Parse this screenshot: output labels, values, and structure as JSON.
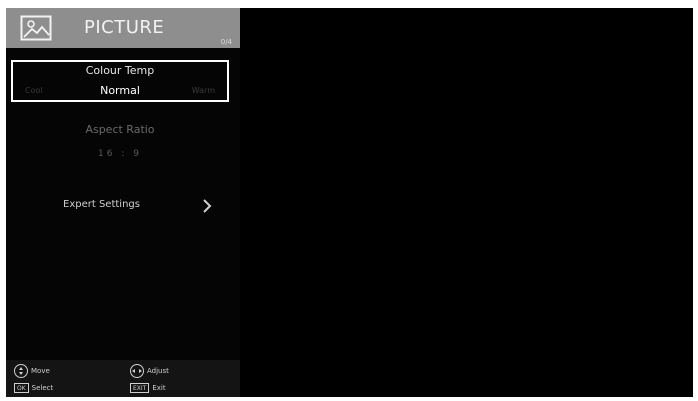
{
  "menu": {
    "title": "PICTURE",
    "title_icon": "picture-icon",
    "badge": "0/4",
    "items": [
      {
        "label": "Colour Temp",
        "value": "Normal",
        "left_hint": "Cool",
        "right_hint": "Warm",
        "selected": true
      },
      {
        "label": "Aspect Ratio",
        "value": "16 : 9",
        "enabled": false
      },
      {
        "label": "Expert Settings",
        "icon": "chevron-right-icon"
      }
    ]
  },
  "footer": {
    "move": {
      "icon": "dpad-updown-icon",
      "label": "Move"
    },
    "adjust": {
      "icon": "dpad-leftright-icon",
      "label": "Adjust"
    },
    "select": {
      "key": "OK",
      "label": "Select"
    },
    "exit": {
      "key": "EXIT",
      "label": "Exit"
    }
  },
  "colors": {
    "header_bg": "#8e8e8e",
    "screen_bg": "#000000",
    "selection_border": "#ffffff"
  }
}
